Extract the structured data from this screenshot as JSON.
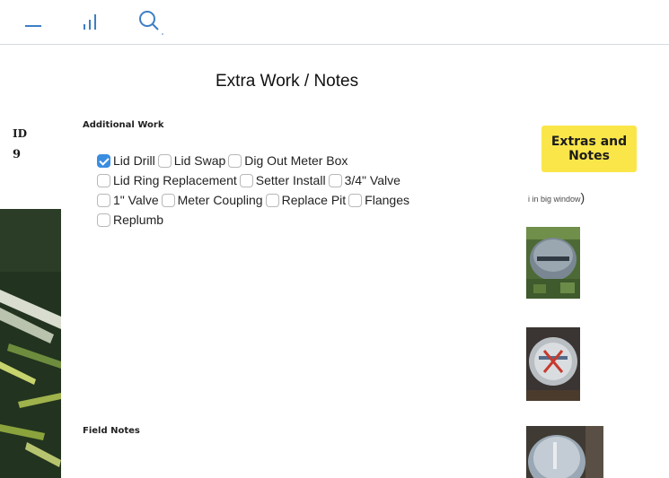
{
  "toolbar": {
    "icons": [
      "minus-icon",
      "signal-bars-icon",
      "search-icon"
    ],
    "accent_color": "#3d7fc4"
  },
  "page_title": "Extra Work / Notes",
  "id_column": {
    "label": "ID",
    "value": "9"
  },
  "additional_work": {
    "label": "Additional Work",
    "rows": [
      [
        {
          "label": "Lid Drill",
          "checked": true
        },
        {
          "label": "Lid Swap",
          "checked": false
        },
        {
          "label": "Dig Out Meter Box",
          "checked": false
        }
      ],
      [
        {
          "label": "Lid Ring Replacement",
          "checked": false
        },
        {
          "label": "Setter Install",
          "checked": false
        },
        {
          "label": "3/4\" Valve",
          "checked": false
        }
      ],
      [
        {
          "label": "1\" Valve",
          "checked": false
        },
        {
          "label": "Meter Coupling",
          "checked": false
        },
        {
          "label": "Replace Pit",
          "checked": false
        },
        {
          "label": "Flanges",
          "checked": false
        }
      ],
      [
        {
          "label": "Replumb",
          "checked": false
        }
      ]
    ]
  },
  "field_notes": {
    "label": "Field Notes"
  },
  "extras_button": {
    "line1": "Extras and",
    "line2": "Notes",
    "color": "#fbe64a"
  },
  "photo_hint": {
    "text": "i in big window",
    "close_paren": ")"
  },
  "checkbox_checked_color": "#3b8de0"
}
